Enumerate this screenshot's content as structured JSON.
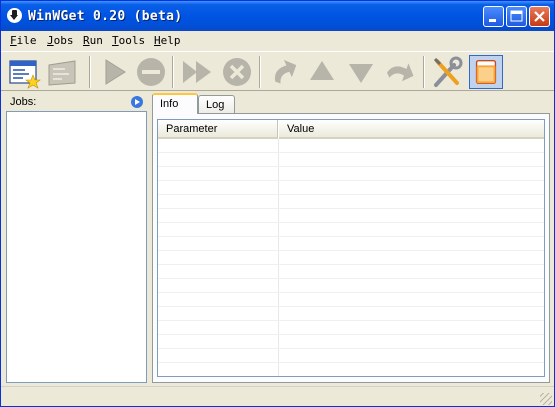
{
  "window": {
    "title": "WinWGet 0.20 (beta)",
    "minimize_label": "Minimize",
    "maximize_label": "Maximize",
    "close_label": "Close"
  },
  "menu": [
    {
      "mnemonic": "F",
      "rest": "ile"
    },
    {
      "mnemonic": "J",
      "rest": "obs"
    },
    {
      "mnemonic": "R",
      "rest": "un"
    },
    {
      "mnemonic": "T",
      "rest": "ools"
    },
    {
      "mnemonic": "H",
      "rest": "elp"
    }
  ],
  "toolbar": [
    {
      "icon": "new-job-icon",
      "enabled": true
    },
    {
      "icon": "edit-job-icon",
      "enabled": false
    },
    {
      "icon": "run-icon",
      "enabled": false
    },
    {
      "icon": "stop-icon",
      "enabled": false
    },
    {
      "icon": "run-all-icon",
      "enabled": false
    },
    {
      "icon": "cancel-icon",
      "enabled": false
    },
    {
      "icon": "move-top-icon",
      "enabled": false
    },
    {
      "icon": "move-up-icon",
      "enabled": false
    },
    {
      "icon": "move-down-icon",
      "enabled": false
    },
    {
      "icon": "move-bottom-icon",
      "enabled": false
    },
    {
      "icon": "settings-icon",
      "enabled": true
    },
    {
      "icon": "toggle-panel-icon",
      "enabled": true
    }
  ],
  "sidebar": {
    "label": "Jobs:",
    "jobs": []
  },
  "tabs": [
    {
      "label": "Info",
      "active": true
    },
    {
      "label": "Log",
      "active": false
    }
  ],
  "grid": {
    "columns": [
      "Parameter",
      "Value"
    ],
    "rows": []
  },
  "status": {
    "text": ""
  },
  "colors": {
    "titlebar": "#0054e3",
    "window_bg": "#ece9d8",
    "tab_highlight": "#ffc83c"
  }
}
